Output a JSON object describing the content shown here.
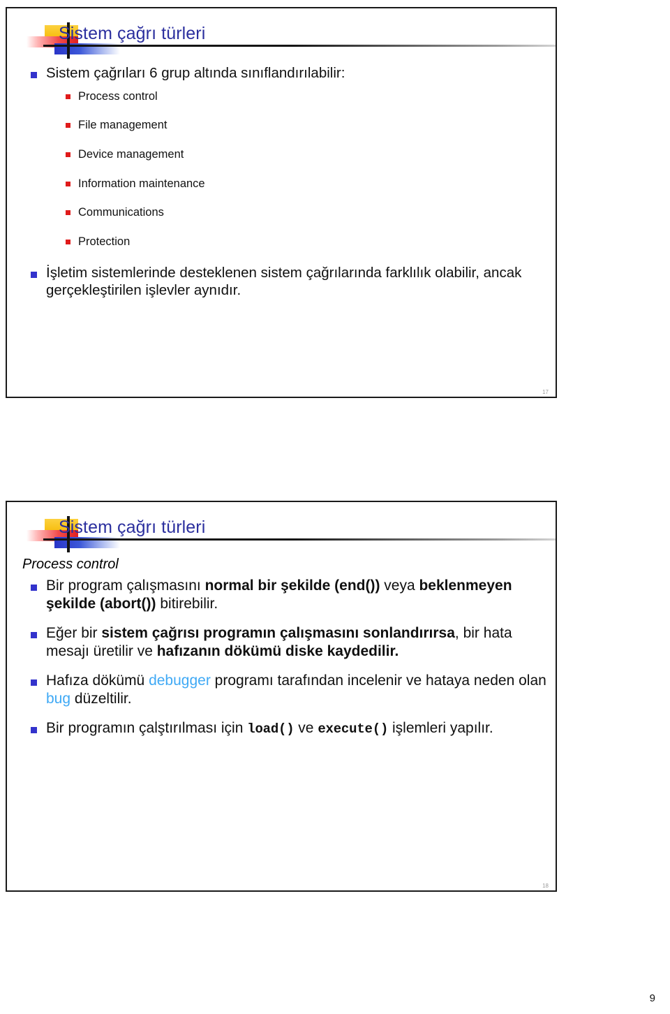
{
  "document": {
    "page_number": "9"
  },
  "slides": [
    {
      "id": "slide-1",
      "title": "Sistem çağrı türleri",
      "slide_number": "17",
      "bullets": {
        "intro": "Sistem çağrıları 6 grup altında sınıflandırılabilir:",
        "sub_items": [
          "Process control",
          "File management",
          "Device management",
          "Information maintenance",
          "Communications",
          "Protection"
        ],
        "closing": "İşletim sistemlerinde desteklenen sistem çağrılarında farklılık olabilir, ancak gerçekleştirilen işlevler aynıdır."
      }
    },
    {
      "id": "slide-2",
      "title": "Sistem çağrı türleri",
      "subhead": "Process control",
      "slide_number": "18",
      "bullets": [
        {
          "parts": [
            {
              "text": "Bir program çalışmasını ",
              "style": "normal"
            },
            {
              "text": "normal bir şekilde (end())",
              "style": "bold"
            },
            {
              "text": " veya ",
              "style": "normal"
            },
            {
              "text": "beklenmeyen şekilde (abort())",
              "style": "bold"
            },
            {
              "text": " bitirebilir.",
              "style": "normal"
            }
          ]
        },
        {
          "parts": [
            {
              "text": "Eğer bir ",
              "style": "normal"
            },
            {
              "text": "sistem çağrısı programın çalışmasını sonlandırırsa",
              "style": "bold"
            },
            {
              "text": ", bir hata mesajı üretilir ve ",
              "style": "normal"
            },
            {
              "text": "hafızanın dökümü diske kaydedilir.",
              "style": "bold"
            }
          ]
        },
        {
          "parts": [
            {
              "text": "Hafıza dökümü ",
              "style": "normal"
            },
            {
              "text": "debugger",
              "style": "highlight"
            },
            {
              "text": " programı tarafından incelenir ve hataya neden olan ",
              "style": "normal"
            },
            {
              "text": "bug",
              "style": "highlight"
            },
            {
              "text": " düzeltilir.",
              "style": "normal"
            }
          ]
        },
        {
          "parts": [
            {
              "text": "Bir programın çalştırılması için ",
              "style": "normal"
            },
            {
              "text": "load()",
              "style": "code"
            },
            {
              "text": " ve ",
              "style": "normal"
            },
            {
              "text": "execute()",
              "style": "code"
            },
            {
              "text": " işlemleri yapılır.",
              "style": "normal"
            }
          ]
        }
      ]
    }
  ],
  "colors": {
    "title": "#2b2f9e",
    "bullet_level1": "#3333cc",
    "bullet_level2": "#e01b1b",
    "highlight": "#3fa9f5",
    "deco_yellow": "#f9c22e",
    "deco_red": "#e02020",
    "deco_blue": "#2a35c8"
  }
}
